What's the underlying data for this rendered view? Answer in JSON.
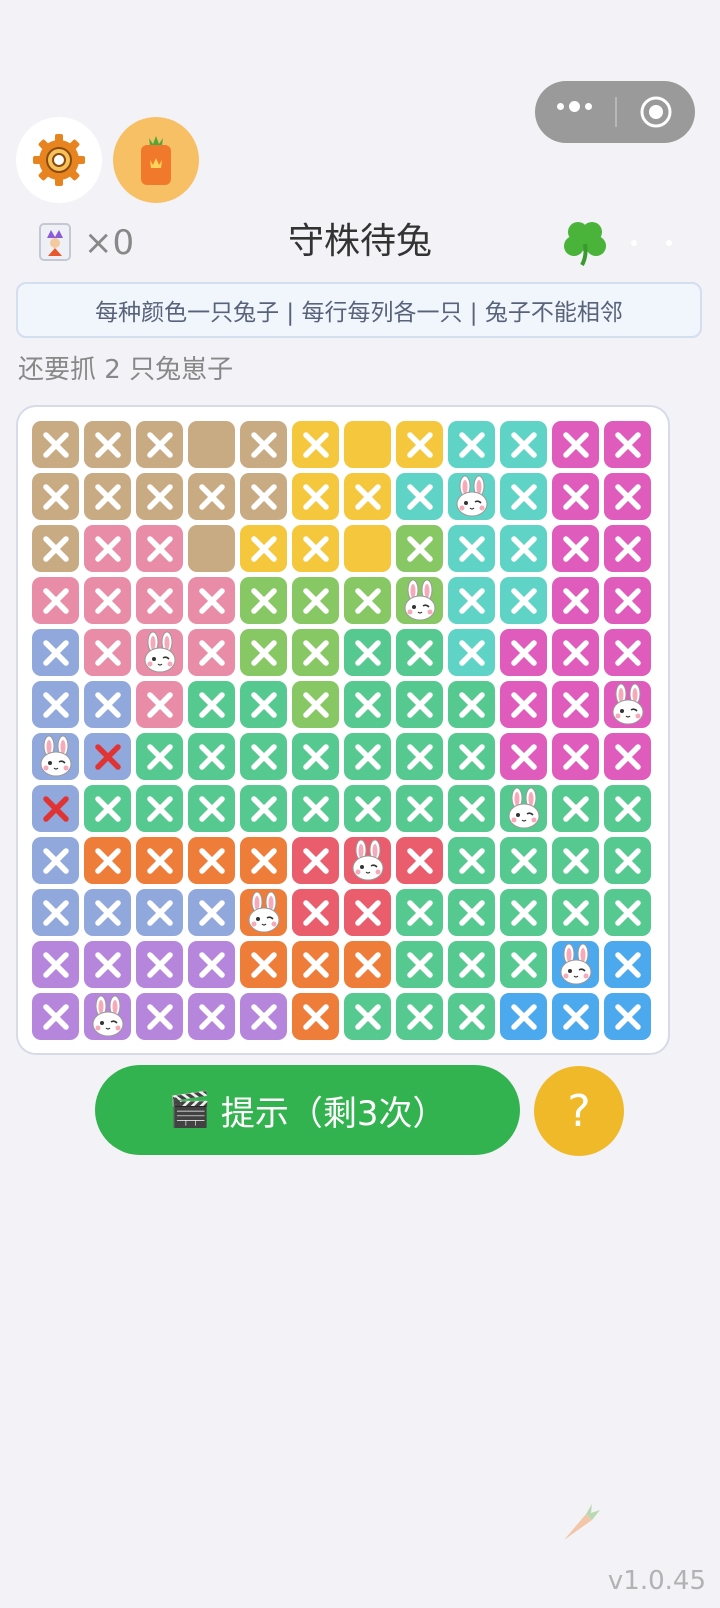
{
  "header": {
    "title": "守株待兔",
    "joker_count": "×0"
  },
  "rules": "每种颜色一只兔子 | 每行每列各一只 | 兔子不能相邻",
  "status": {
    "remaining": "还要抓 2 只兔崽子"
  },
  "colors": {
    "T": "#c8aa83",
    "Y": "#f5c73c",
    "C": "#5fd3c6",
    "M": "#df5cbd",
    "P": "#e98ca8",
    "L": "#87c865",
    "B": "#91a8dd",
    "G": "#55c98f",
    "O": "#ef7d3a",
    "R": "#ea5d6c",
    "V": "#b586dc",
    "S": "#4ca9ee"
  },
  "board": {
    "size": 12,
    "regions": [
      "TTTTTYYYCCMM",
      "TTTTTYYCCCMM",
      "TPPTYYYLCCMM",
      "PPPPLLLLCCMM",
      "BPPPLLGGCMMM",
      "BBPGGLGGGMMM",
      "BBGGGGGGGMMM",
      "BGGGGGGGGGGG",
      "BOOOORRRGGGG",
      "BBBBORRGGGGG",
      "VVVVOOOGGGSS",
      "VVVVVOGGGSSS"
    ],
    "marks": [
      "XXX.XX.XXXXX",
      "XXXXXXXXRXXX",
      "XXX.XX.XXXXX",
      "XXXXXXXRXXXX",
      "XXRXXXXXXXXX",
      "XXXXXXXXXXXR",
      "RWXXXXXXXXXX",
      "WXXXXXXXXRXX",
      "XXXXXXRXXXXX",
      "XXXXRXXXXXXX",
      "XXXXXXXXXXRX",
      "XRXXXXXXXXXX"
    ]
  },
  "hint_button": {
    "icon": "🎬",
    "label": "提示（剩3次）"
  },
  "help_button": {
    "label": "?"
  },
  "version": "v1.0.45"
}
